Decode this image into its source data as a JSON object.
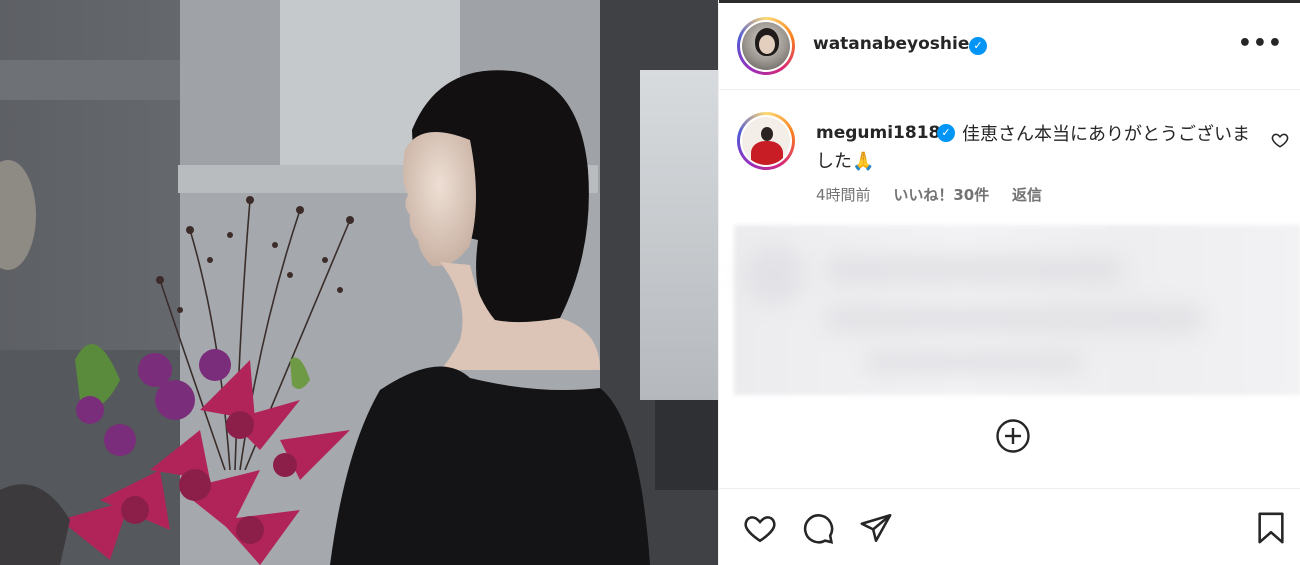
{
  "post": {
    "author": {
      "username": "watanabeyoshie",
      "verified": true
    },
    "more_icon": "more-horizontal-icon"
  },
  "comment": {
    "username": "megumi1818",
    "verified": true,
    "text": "佳恵さん本当にありがとうございました🙏",
    "time": "4時間前",
    "likes": "いいね！30件",
    "reply": "返信"
  },
  "actions": {
    "icons": [
      "heart-icon",
      "comment-icon",
      "share-icon",
      "bookmark-icon"
    ]
  },
  "colors": {
    "verified_blue": "#0095f6",
    "text": "#262626",
    "muted": "#737373",
    "divider": "#efefef"
  }
}
